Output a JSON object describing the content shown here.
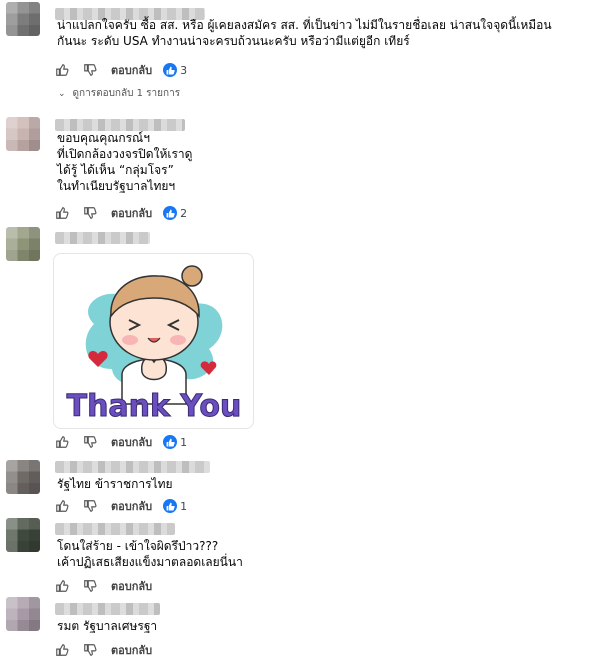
{
  "comments": [
    {
      "lines": [
        "น่าแปลกใจครับ ซื้อ สส. หรือ ผู้เคยลงสมัคร สส. ที่เป็นข่าว ไม่มีในรายชื่อเลย น่าสนใจจุดนี้เหมือน",
        "กันนะ ระดับ USA ทำงานน่าจะครบถ้วนนะครับ หรือว่ามีแต่ยูอีก เทียร์"
      ],
      "reply_label": "ตอบกลับ",
      "reaction_count": "3"
    },
    {
      "lines": [
        "ขอบคุณคุณกรณ์ฯ",
        "ที่เปิดกล้องวงจรปิดให้เราดู",
        "ได้รู้ ได้เห็น “กลุ่มโจร”",
        "ในทำเนียบรัฐบาลไทยฯ"
      ],
      "reply_label": "ตอบกลับ",
      "reaction_count": "2"
    },
    {
      "lines": [],
      "sticker_text": "Thank You",
      "reply_label": "ตอบกลับ",
      "reaction_count": "1"
    },
    {
      "lines": [
        "รัฐไทย ข้าราชการไทย"
      ],
      "reply_label": "ตอบกลับ",
      "reaction_count": "1"
    },
    {
      "lines": [
        "โดนใส่ร้าย - เข้าใจผิดรึป่าว???",
        "เค้าปฏิเสธเสียงแข็งมาตลอดเลยนี่นา"
      ],
      "reply_label": "ตอบกลับ",
      "reaction_count": ""
    },
    {
      "lines": [
        "รมต รัฐบาลเศษรฐา"
      ],
      "reply_label": "ตอบกลับ",
      "reaction_count": ""
    }
  ],
  "view_replies_label": "ดูการตอบกลับ 1 รายการ",
  "icons": {
    "like": "thumbs-up-icon",
    "dislike": "thumbs-down-icon",
    "reaction": "like-reaction-icon"
  },
  "colors": {
    "reaction_blue": "#1877f2"
  }
}
